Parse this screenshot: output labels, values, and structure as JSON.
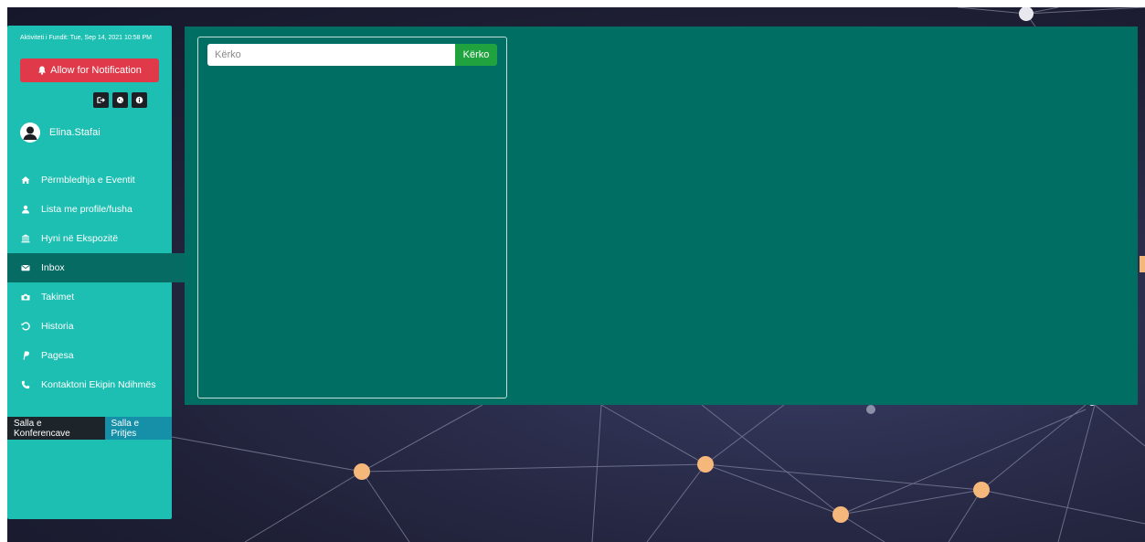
{
  "sidebar": {
    "last_activity": "Aktiviteti i Fundit: Tue, Sep 14, 2021 10:58 PM",
    "notification_button": "Allow for Notification",
    "mini_icons": [
      "sign-out-icon",
      "globe-icon",
      "info-icon"
    ],
    "username": "Elina.Stafai",
    "items": [
      {
        "label": "Përmbledhja e Eventit",
        "icon": "home-icon"
      },
      {
        "label": "Lista me profile/fusha",
        "icon": "user-icon"
      },
      {
        "label": "Hyni në Ekspozitë",
        "icon": "bank-icon"
      },
      {
        "label": "Inbox",
        "icon": "envelope-icon",
        "active": true
      },
      {
        "label": "Takimet",
        "icon": "camera-icon"
      },
      {
        "label": "Historia",
        "icon": "history-icon"
      },
      {
        "label": "Pagesa",
        "icon": "paypal-icon"
      },
      {
        "label": "Kontaktoni Ekipin Ndihmës",
        "icon": "phone-icon"
      }
    ],
    "room_tabs": {
      "conference": "Salla e Konferencave",
      "reception": "Salla e Pritjes"
    }
  },
  "inbox": {
    "search_placeholder": "Kërko",
    "search_button": "Kërko"
  },
  "colors": {
    "sidebar": "#1cbfb1",
    "active_item": "#056b63",
    "main_panel": "#006e63",
    "notification": "#e0394a",
    "search_button": "#20a33f",
    "node": "#f5b77a"
  }
}
